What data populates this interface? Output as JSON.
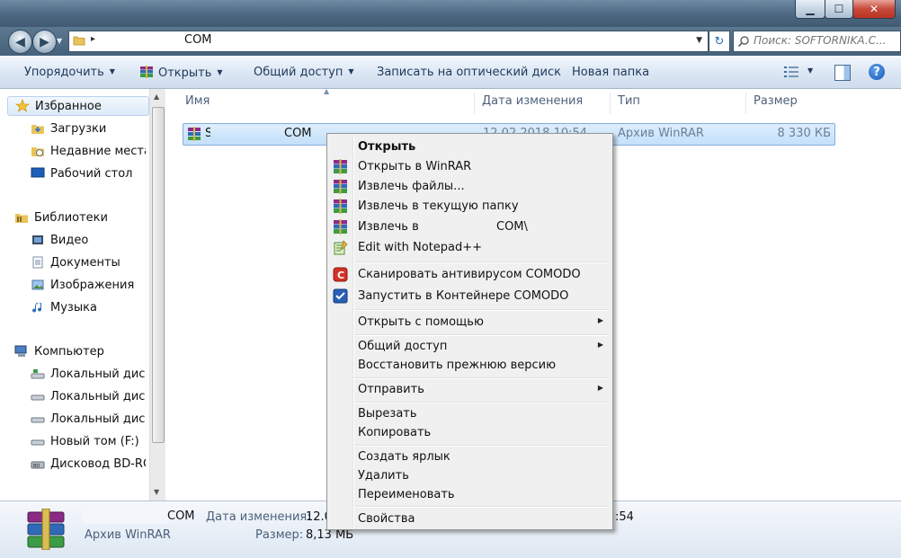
{
  "window": {
    "minimize_glyph": "▁",
    "maximize_glyph": "☐",
    "close_glyph": "✕"
  },
  "address": {
    "path": "COM",
    "search_placeholder": "Поиск: SOFTORNIKA.C..."
  },
  "toolbar": {
    "organize": "Упорядочить",
    "open": "Открыть",
    "share": "Общий доступ",
    "burn": "Записать на оптический диск",
    "new_folder": "Новая папка",
    "help": "?"
  },
  "nav": {
    "favorites": "Избранное",
    "downloads": "Загрузки",
    "recent": "Недавние места",
    "desktop": "Рабочий стол",
    "libraries": "Библиотеки",
    "video": "Видео",
    "documents": "Документы",
    "pictures": "Изображения",
    "music": "Музыка",
    "computer": "Компьютер",
    "disk1": "Локальный диск (",
    "disk2": "Локальный диск (",
    "disk3": "Локальный диск (",
    "new_volume": "Новый том (F:)",
    "bd_drive": "Дисковод BD-RO"
  },
  "columns": {
    "name": "Имя",
    "date": "Дата изменения",
    "type": "Тип",
    "size": "Размер"
  },
  "file": {
    "name_prefix": "S",
    "name_suffix": "COM",
    "date": "12.02.2018 10:54",
    "type": "Архив WinRAR",
    "size": "8 330 КБ"
  },
  "details": {
    "name": "COM",
    "type": "Архив WinRAR",
    "date_label": "Дата изменения:",
    "date_value": "12.0",
    "date_tail": ":54",
    "size_label": "Размер:",
    "size_value": "8,13 МБ"
  },
  "context_menu": {
    "open": "Открыть",
    "open_winrar": "Открыть в WinRAR",
    "extract_files": "Извлечь файлы...",
    "extract_here": "Извлечь в текущую папку",
    "extract_to_prefix": "Извлечь в",
    "extract_to_suffix": "COM\\",
    "notepad": "Edit with Notepad++",
    "scan_comodo": "Сканировать антивирусом COMODO",
    "container_comodo": "Запустить в Контейнере COMODO",
    "open_with": "Открыть с помощью",
    "share": "Общий доступ",
    "restore": "Восстановить прежнюю версию",
    "send_to": "Отправить",
    "cut": "Вырезать",
    "copy": "Копировать",
    "create_shortcut": "Создать ярлык",
    "delete": "Удалить",
    "rename": "Переименовать",
    "properties": "Свойства"
  },
  "colors": {
    "accent": "#1e395b",
    "selection": "#c4e0fa",
    "menu_bg": "#f0f0f0"
  },
  "icons": {
    "winrar": "winrar-archive-icon",
    "comodo_scan": "comodo-scan-icon",
    "comodo_container": "comodo-container-icon",
    "notepad": "notepad-plus-icon"
  }
}
